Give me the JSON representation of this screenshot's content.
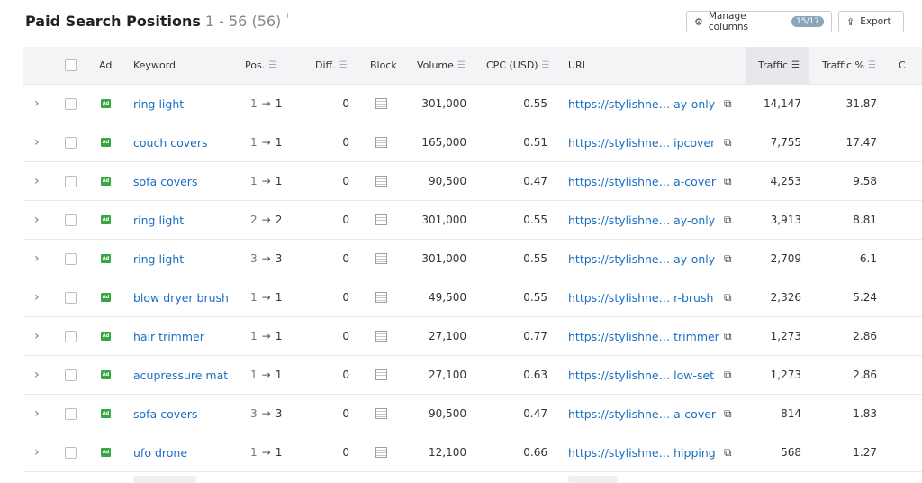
{
  "header": {
    "title": "Paid Search Positions",
    "range": "1 - 56 (56)",
    "info": "i"
  },
  "toolbar": {
    "manage_label": "Manage columns",
    "manage_badge": "15/17",
    "export_label": "Export"
  },
  "icons": {
    "gear": "gear-icon",
    "export": "export-icon",
    "chevron": "chevron-right-icon",
    "ad": "ad-icon",
    "block": "block-icon",
    "external": "external-link-icon"
  },
  "colors": {
    "link": "#1a6fc3",
    "ad_badge": "#3aa547",
    "header_bg": "#f3f4f6",
    "badge_bg": "#8aa4b8"
  },
  "columns": {
    "ad": "Ad",
    "keyword": "Keyword",
    "pos": "Pos.",
    "diff": "Diff.",
    "block": "Block",
    "volume": "Volume",
    "cpc": "CPC (USD)",
    "url": "URL",
    "traffic": "Traffic",
    "traffic_pct": "Traffic %",
    "next": "C"
  },
  "rows": [
    {
      "keyword": "ring light",
      "pos_prev": "1",
      "pos_cur": "1",
      "diff": "0",
      "volume": "301,000",
      "cpc": "0.55",
      "url_start": "https://stylishne…",
      "url_end": "ay-only",
      "traffic": "14,147",
      "traffic_pct": "31.87"
    },
    {
      "keyword": "couch covers",
      "pos_prev": "1",
      "pos_cur": "1",
      "diff": "0",
      "volume": "165,000",
      "cpc": "0.51",
      "url_start": "https://stylishne…",
      "url_end": "ipcover",
      "traffic": "7,755",
      "traffic_pct": "17.47"
    },
    {
      "keyword": "sofa covers",
      "pos_prev": "1",
      "pos_cur": "1",
      "diff": "0",
      "volume": "90,500",
      "cpc": "0.47",
      "url_start": "https://stylishne…",
      "url_end": "a-cover",
      "traffic": "4,253",
      "traffic_pct": "9.58"
    },
    {
      "keyword": "ring light",
      "pos_prev": "2",
      "pos_cur": "2",
      "diff": "0",
      "volume": "301,000",
      "cpc": "0.55",
      "url_start": "https://stylishne…",
      "url_end": "ay-only",
      "traffic": "3,913",
      "traffic_pct": "8.81"
    },
    {
      "keyword": "ring light",
      "pos_prev": "3",
      "pos_cur": "3",
      "diff": "0",
      "volume": "301,000",
      "cpc": "0.55",
      "url_start": "https://stylishne…",
      "url_end": "ay-only",
      "traffic": "2,709",
      "traffic_pct": "6.1"
    },
    {
      "keyword": "blow dryer brush",
      "pos_prev": "1",
      "pos_cur": "1",
      "diff": "0",
      "volume": "49,500",
      "cpc": "0.55",
      "url_start": "https://stylishne…",
      "url_end": "r-brush",
      "traffic": "2,326",
      "traffic_pct": "5.24"
    },
    {
      "keyword": "hair trimmer",
      "pos_prev": "1",
      "pos_cur": "1",
      "diff": "0",
      "volume": "27,100",
      "cpc": "0.77",
      "url_start": "https://stylishne…",
      "url_end": "trimmer",
      "traffic": "1,273",
      "traffic_pct": "2.86"
    },
    {
      "keyword": "acupressure mat",
      "pos_prev": "1",
      "pos_cur": "1",
      "diff": "0",
      "volume": "27,100",
      "cpc": "0.63",
      "url_start": "https://stylishne…",
      "url_end": "low-set",
      "traffic": "1,273",
      "traffic_pct": "2.86"
    },
    {
      "keyword": "sofa covers",
      "pos_prev": "3",
      "pos_cur": "3",
      "diff": "0",
      "volume": "90,500",
      "cpc": "0.47",
      "url_start": "https://stylishne…",
      "url_end": "a-cover",
      "traffic": "814",
      "traffic_pct": "1.83"
    },
    {
      "keyword": "ufo drone",
      "pos_prev": "1",
      "pos_cur": "1",
      "diff": "0",
      "volume": "12,100",
      "cpc": "0.66",
      "url_start": "https://stylishne…",
      "url_end": "hipping",
      "traffic": "568",
      "traffic_pct": "1.27"
    }
  ]
}
